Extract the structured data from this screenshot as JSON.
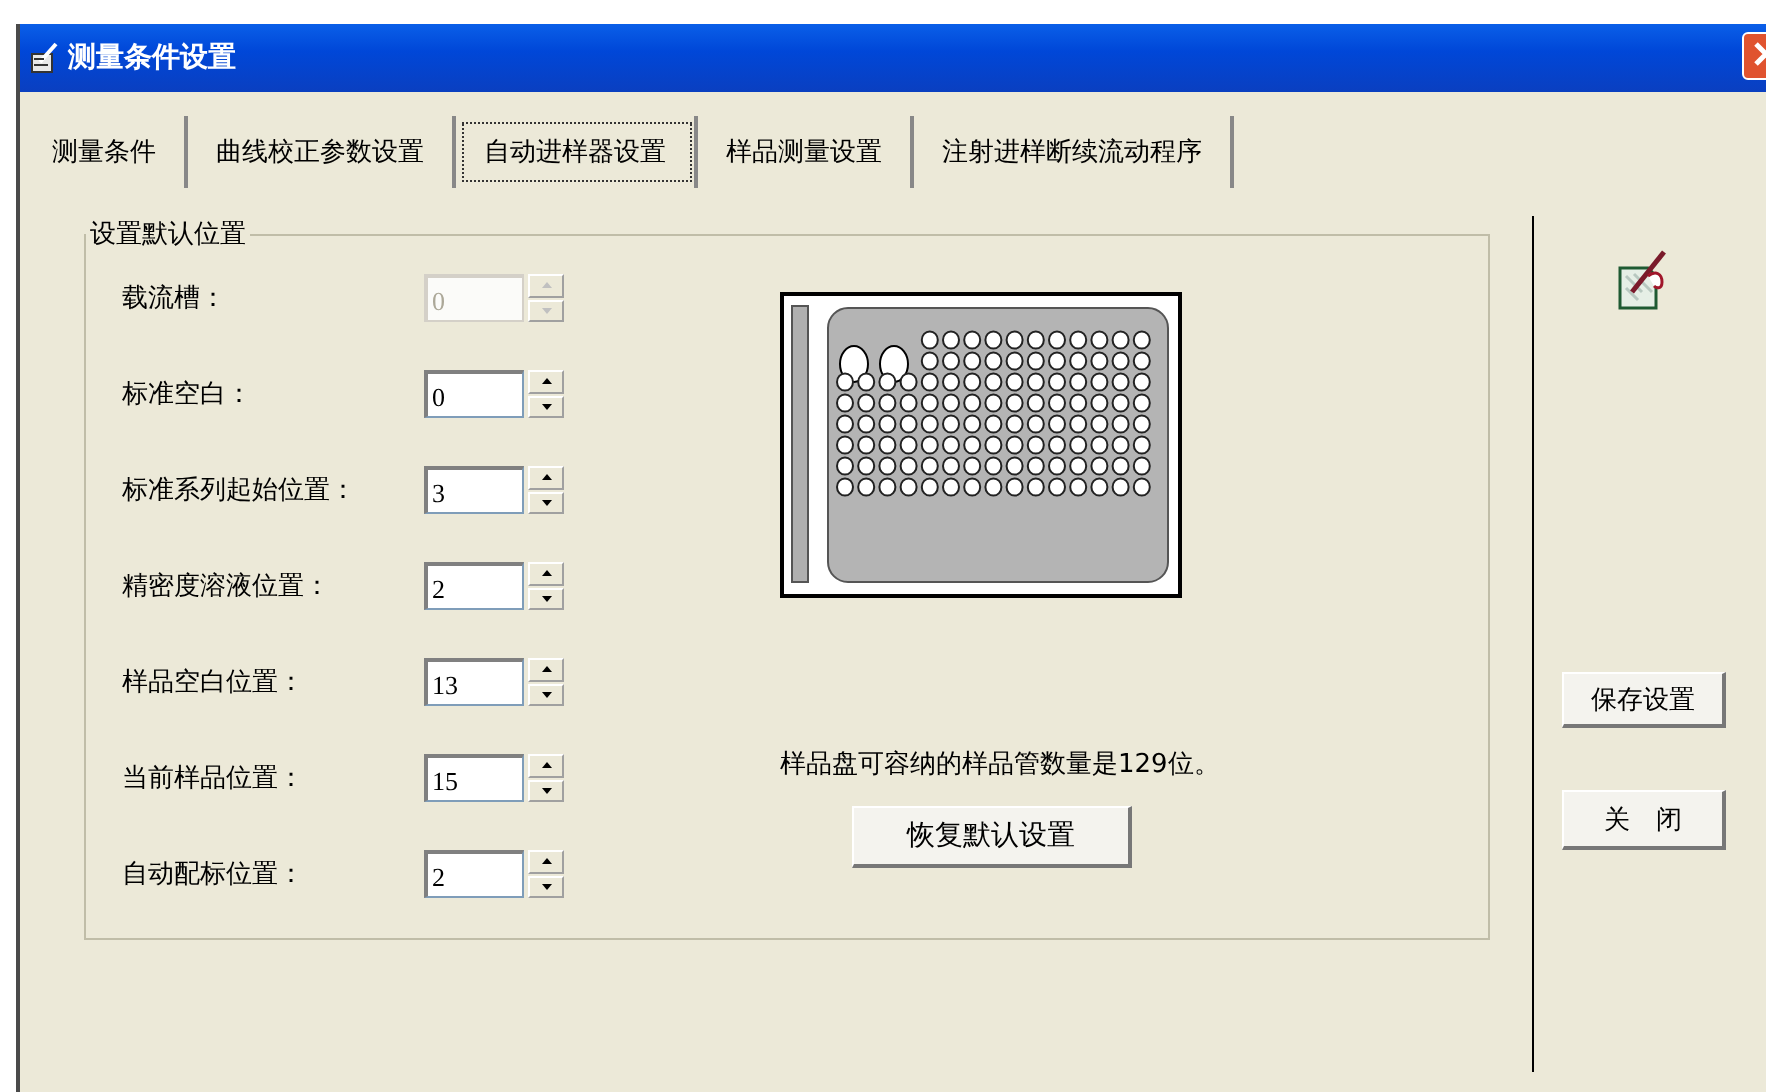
{
  "window": {
    "title": "测量条件设置"
  },
  "tabs": [
    {
      "label": "测量条件",
      "selected": false
    },
    {
      "label": "曲线校正参数设置",
      "selected": false
    },
    {
      "label": "自动进样器设置",
      "selected": true
    },
    {
      "label": "样品测量设置",
      "selected": false
    },
    {
      "label": "注射进样断续流动程序",
      "selected": false
    }
  ],
  "group": {
    "title": "设置默认位置",
    "fields": [
      {
        "label": "载流槽：",
        "value": "0",
        "disabled": true
      },
      {
        "label": "标准空白：",
        "value": "0",
        "disabled": false
      },
      {
        "label": "标准系列起始位置：",
        "value": "3",
        "disabled": false
      },
      {
        "label": "精密度溶液位置：",
        "value": "2",
        "disabled": false
      },
      {
        "label": "样品空白位置：",
        "value": "13",
        "disabled": false
      },
      {
        "label": "当前样品位置：",
        "value": "15",
        "disabled": false
      },
      {
        "label": "自动配标位置：",
        "value": "2",
        "disabled": false
      }
    ]
  },
  "capacity_note": "样品盘可容纳的样品管数量是129位。",
  "restore_button": "恢复默认设置",
  "buttons": [
    "保存设置",
    "关　闭"
  ]
}
